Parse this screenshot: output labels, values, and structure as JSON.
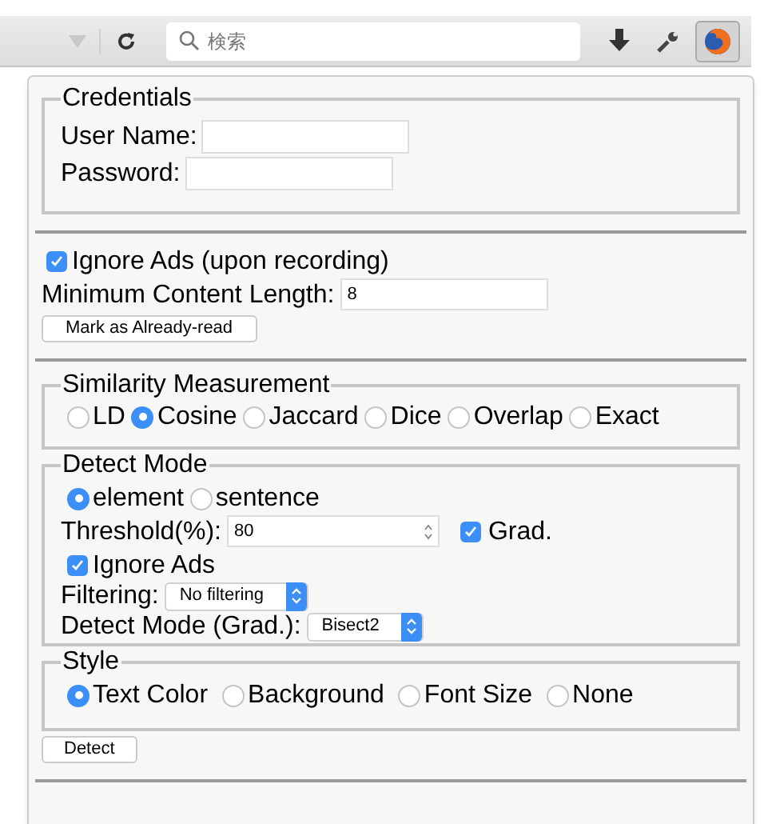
{
  "toolbar": {
    "search_placeholder": "検索"
  },
  "credentials": {
    "legend": "Credentials",
    "fields": [
      {
        "label": "User Name:"
      },
      {
        "label": "Password:"
      }
    ]
  },
  "ignore_ads_recording": {
    "label": "Ignore Ads (upon recording)",
    "checked": true
  },
  "min_content_length": {
    "label": "Minimum Content Length:",
    "value": "8"
  },
  "mark_button": "Mark as Already-read",
  "similarity": {
    "legend": "Similarity Measurement",
    "options": [
      {
        "label": "LD",
        "selected": false
      },
      {
        "label": "Cosine",
        "selected": true
      },
      {
        "label": "Jaccard",
        "selected": false
      },
      {
        "label": "Dice",
        "selected": false
      },
      {
        "label": "Overlap",
        "selected": false
      },
      {
        "label": "Exact",
        "selected": false
      }
    ]
  },
  "detect_mode": {
    "legend": "Detect Mode",
    "modes": [
      {
        "label": "element",
        "selected": true
      },
      {
        "label": "sentence",
        "selected": false
      }
    ],
    "threshold": {
      "label": "Threshold(%):",
      "value": "80"
    },
    "grad": {
      "label": "Grad.",
      "checked": true
    },
    "ignore_ads": {
      "label": "Ignore Ads",
      "checked": true
    },
    "filtering": {
      "label": "Filtering:",
      "value": "No filtering"
    },
    "grad_mode": {
      "label": "Detect Mode (Grad.):",
      "value": "Bisect2"
    }
  },
  "style": {
    "legend": "Style",
    "options": [
      {
        "label": "Text Color",
        "selected": true
      },
      {
        "label": "Background",
        "selected": false
      },
      {
        "label": "Font Size",
        "selected": false
      },
      {
        "label": "None",
        "selected": false
      }
    ]
  },
  "detect_button": "Detect"
}
